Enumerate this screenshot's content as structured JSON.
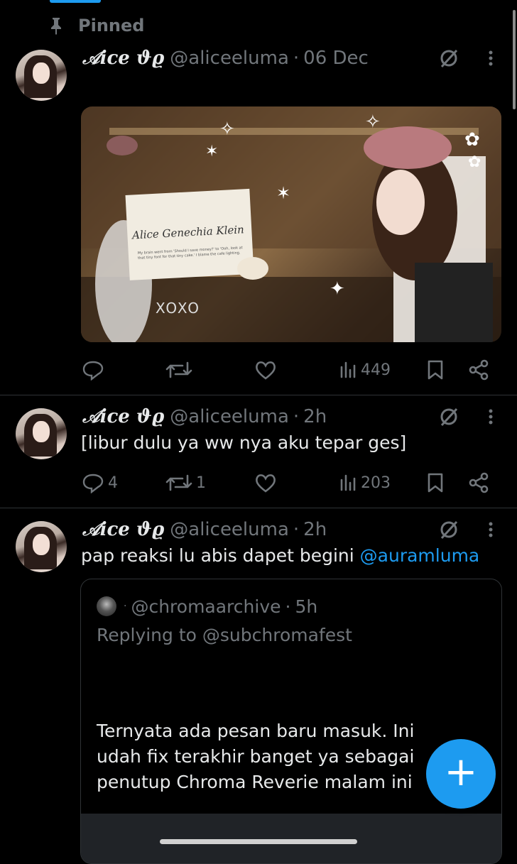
{
  "pinned": {
    "label": "Pinned"
  },
  "tweets": [
    {
      "name": "𝒜ice ϑϱ",
      "handle": "@aliceeluma",
      "sep": "·",
      "time": "06 Dec",
      "media": {
        "card_title": "Alice Genechia Klein",
        "card_caption": "My brain went from 'Should I save money?' to 'Ooh, look at that tiny font for that tiny cake.' I blame the cafe lighting.",
        "xoxo": "XOXO"
      },
      "actions": {
        "views": "449"
      }
    },
    {
      "name": "𝒜ice ϑϱ",
      "handle": "@aliceeluma",
      "sep": "·",
      "time": "2h",
      "text": "[libur dulu ya ww nya aku tepar ges]",
      "actions": {
        "replies": "4",
        "retweets": "1",
        "views": "203"
      }
    },
    {
      "name": "𝒜ice ϑϱ",
      "handle": "@aliceeluma",
      "sep": "·",
      "time": "2h",
      "text": "pap reaksi lu abis dapet begini",
      "mention": "@auramluma",
      "quote": {
        "prefix": "·",
        "handle": "@chromaarchive",
        "sep": "·",
        "time": "5h",
        "replying": "Replying to @subchromafest",
        "lines": [
          "Ternyata ada pesan baru masuk. Ini",
          "udah fix terakhir banget ya sebagai",
          "penutup Chroma Reverie malam ini"
        ]
      }
    }
  ],
  "fab": {
    "label": "+"
  },
  "colors": {
    "accent": "#1d9bf0",
    "muted": "#71767b",
    "divider": "#2f3336",
    "background": "#000000"
  }
}
